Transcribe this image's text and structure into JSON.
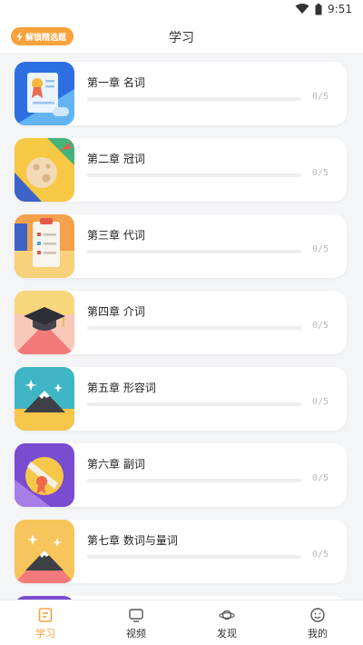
{
  "status": {
    "time": "9:51"
  },
  "header": {
    "badge": "解锁精选题",
    "title": "学习"
  },
  "chapters": [
    {
      "title": "第一章  名词",
      "progress": "0/5",
      "completed": 0,
      "total": 5,
      "icon": "certificate-icon"
    },
    {
      "title": "第二章  冠词",
      "progress": "0/5",
      "completed": 0,
      "total": 5,
      "icon": "planet-comet-icon"
    },
    {
      "title": "第三章  代词",
      "progress": "0/5",
      "completed": 0,
      "total": 5,
      "icon": "checklist-board-icon"
    },
    {
      "title": "第四章  介词",
      "progress": "0/5",
      "completed": 0,
      "total": 5,
      "icon": "graduation-cap-icon"
    },
    {
      "title": "第五章  形容词",
      "progress": "0/5",
      "completed": 0,
      "total": 5,
      "icon": "mountain-stars-icon"
    },
    {
      "title": "第六章  副词",
      "progress": "0/5",
      "completed": 0,
      "total": 5,
      "icon": "award-ribbon-icon"
    },
    {
      "title": "第七章  数词与量词",
      "progress": "0/5",
      "completed": 0,
      "total": 5,
      "icon": "mountain-stars-icon"
    }
  ],
  "nav": [
    {
      "label": "学习",
      "icon": "study-icon",
      "active": true
    },
    {
      "label": "视频",
      "icon": "tv-icon",
      "active": false
    },
    {
      "label": "发现",
      "icon": "planet-icon",
      "active": false
    },
    {
      "label": "我的",
      "icon": "smiley-icon",
      "active": false
    }
  ],
  "colors": {
    "accent": "#f7a23b",
    "background": "#f4f5f7"
  }
}
